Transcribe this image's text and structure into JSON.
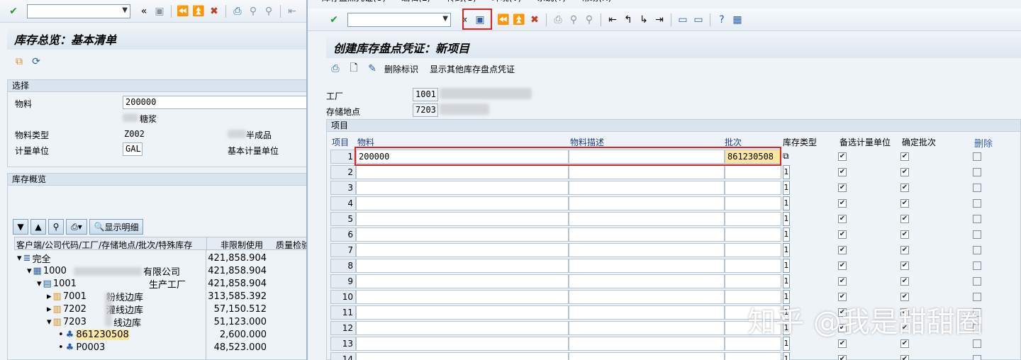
{
  "left": {
    "title": "库存总览：基本清单",
    "selection": {
      "header": "选择",
      "material_label": "物料",
      "material_value": "200000",
      "material_desc": "糖浆",
      "mat_type_label": "物料类型",
      "mat_type_value": "Z002",
      "mat_type_desc": "半成品",
      "uom_label": "计量单位",
      "uom_value": "GAL",
      "base_uom_label": "基本计量单位"
    },
    "overview": {
      "header": "库存概览",
      "show_detail": "显示明细",
      "col_tree": "客户端/公司代码/工厂/存储地点/批次/特殊库存",
      "col_unrestricted": "非限制使用",
      "col_qi": "质量检验",
      "rows": [
        {
          "label": "完全",
          "value": "421,858.904"
        },
        {
          "label": "1000",
          "suffix": "有限公司",
          "value": "421,858.904"
        },
        {
          "label": "1001",
          "suffix": "生产工厂",
          "value": "421,858.904"
        },
        {
          "label": "7001",
          "suffix": "粉线边库",
          "value": "313,585.392"
        },
        {
          "label": "7202",
          "suffix": "灌线边库",
          "value": "57,150.512"
        },
        {
          "label": "7203",
          "suffix": "线边库",
          "value": "51,123.000"
        },
        {
          "label": "861230508",
          "value": "2,600.000"
        },
        {
          "label": "P0003",
          "value": "48,523.000"
        }
      ]
    }
  },
  "right": {
    "menu": [
      "库存盘点凭证(U)",
      "编辑(E)",
      "转到(G)",
      "环境(V)",
      "系统(Y)",
      "帮助(H)"
    ],
    "title": "创建库存盘点凭证：新项目",
    "toolbar": {
      "delete_flag": "删除标识",
      "show_other": "显示其他库存盘点凭证"
    },
    "plant_label": "工厂",
    "plant_value": "1001",
    "sloc_label": "存储地点",
    "sloc_value": "7203",
    "items_header": "项目",
    "columns": {
      "item": "项目",
      "material": "物料",
      "mat_desc": "物料描述",
      "batch": "批次",
      "stock_type": "库存类型",
      "alt_uom": "备选计量单位",
      "fix_batch": "确定批次",
      "delete": "删除"
    },
    "first_row": {
      "material": "200000",
      "batch": "861230508"
    },
    "row_numbers": [
      "1",
      "2",
      "3",
      "4",
      "5",
      "6",
      "7",
      "8",
      "9",
      "10",
      "11",
      "12",
      "13",
      "14"
    ],
    "stock_type_default": "1"
  },
  "watermark": "知乎 @我是甜甜圈"
}
